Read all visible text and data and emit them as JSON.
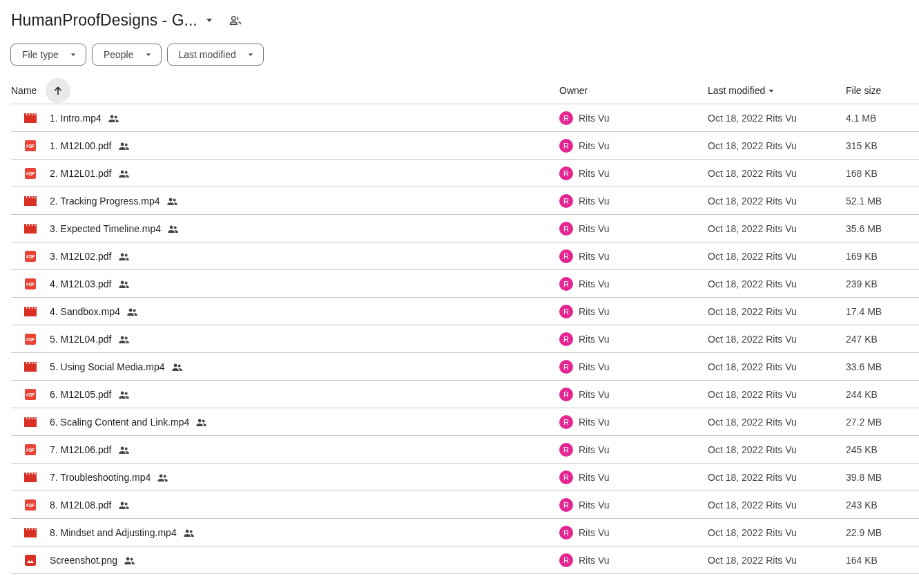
{
  "header": {
    "title": "HumanProofDesigns - G..."
  },
  "filters": [
    {
      "label": "File type"
    },
    {
      "label": "People"
    },
    {
      "label": "Last modified"
    }
  ],
  "table": {
    "columns": [
      {
        "label": "Name"
      },
      {
        "label": "Owner"
      },
      {
        "label": "Last modified"
      },
      {
        "label": "File size"
      }
    ],
    "rows": [
      {
        "kind": "video",
        "name": "1. Intro.mp4",
        "shared": true,
        "avatar": "R",
        "owner": "Rits Vu",
        "modified": "Oct 18, 2022",
        "modified_by": "Rits Vu",
        "size": "4.1 MB"
      },
      {
        "kind": "pdf",
        "name": "1. M12L00.pdf",
        "shared": true,
        "avatar": "R",
        "owner": "Rits Vu",
        "modified": "Oct 18, 2022",
        "modified_by": "Rits Vu",
        "size": "315 KB"
      },
      {
        "kind": "pdf",
        "name": "2. M12L01.pdf",
        "shared": true,
        "avatar": "R",
        "owner": "Rits Vu",
        "modified": "Oct 18, 2022",
        "modified_by": "Rits Vu",
        "size": "168 KB"
      },
      {
        "kind": "video",
        "name": "2. Tracking Progress.mp4",
        "shared": true,
        "avatar": "R",
        "owner": "Rits Vu",
        "modified": "Oct 18, 2022",
        "modified_by": "Rits Vu",
        "size": "52.1 MB"
      },
      {
        "kind": "video",
        "name": "3. Expected Timeline.mp4",
        "shared": true,
        "avatar": "R",
        "owner": "Rits Vu",
        "modified": "Oct 18, 2022",
        "modified_by": "Rits Vu",
        "size": "35.6 MB"
      },
      {
        "kind": "pdf",
        "name": "3. M12L02.pdf",
        "shared": true,
        "avatar": "R",
        "owner": "Rits Vu",
        "modified": "Oct 18, 2022",
        "modified_by": "Rits Vu",
        "size": "169 KB"
      },
      {
        "kind": "pdf",
        "name": "4. M12L03.pdf",
        "shared": true,
        "avatar": "R",
        "owner": "Rits Vu",
        "modified": "Oct 18, 2022",
        "modified_by": "Rits Vu",
        "size": "239 KB"
      },
      {
        "kind": "video",
        "name": "4. Sandbox.mp4",
        "shared": true,
        "avatar": "R",
        "owner": "Rits Vu",
        "modified": "Oct 18, 2022",
        "modified_by": "Rits Vu",
        "size": "17.4 MB"
      },
      {
        "kind": "pdf",
        "name": "5. M12L04.pdf",
        "shared": true,
        "avatar": "R",
        "owner": "Rits Vu",
        "modified": "Oct 18, 2022",
        "modified_by": "Rits Vu",
        "size": "247 KB"
      },
      {
        "kind": "video",
        "name": "5. Using Social Media.mp4",
        "shared": true,
        "avatar": "R",
        "owner": "Rits Vu",
        "modified": "Oct 18, 2022",
        "modified_by": "Rits Vu",
        "size": "33.6 MB"
      },
      {
        "kind": "pdf",
        "name": "6. M12L05.pdf",
        "shared": true,
        "avatar": "R",
        "owner": "Rits Vu",
        "modified": "Oct 18, 2022",
        "modified_by": "Rits Vu",
        "size": "244 KB"
      },
      {
        "kind": "video",
        "name": "6. Scaling Content and Link.mp4",
        "shared": true,
        "avatar": "R",
        "owner": "Rits Vu",
        "modified": "Oct 18, 2022",
        "modified_by": "Rits Vu",
        "size": "27.2 MB"
      },
      {
        "kind": "pdf",
        "name": "7. M12L06.pdf",
        "shared": true,
        "avatar": "R",
        "owner": "Rits Vu",
        "modified": "Oct 18, 2022",
        "modified_by": "Rits Vu",
        "size": "245 KB"
      },
      {
        "kind": "video",
        "name": "7. Troubleshooting.mp4",
        "shared": true,
        "avatar": "R",
        "owner": "Rits Vu",
        "modified": "Oct 18, 2022",
        "modified_by": "Rits Vu",
        "size": "39.8 MB"
      },
      {
        "kind": "pdf",
        "name": "8. M12L08.pdf",
        "shared": true,
        "avatar": "R",
        "owner": "Rits Vu",
        "modified": "Oct 18, 2022",
        "modified_by": "Rits Vu",
        "size": "243 KB"
      },
      {
        "kind": "video",
        "name": "8. Mindset and Adjusting.mp4",
        "shared": true,
        "avatar": "R",
        "owner": "Rits Vu",
        "modified": "Oct 18, 2022",
        "modified_by": "Rits Vu",
        "size": "22.9 MB"
      },
      {
        "kind": "image",
        "name": "Screenshot.png",
        "shared": true,
        "avatar": "R",
        "owner": "Rits Vu",
        "modified": "Oct 18, 2022",
        "modified_by": "Rits Vu",
        "size": "164 KB"
      }
    ]
  }
}
